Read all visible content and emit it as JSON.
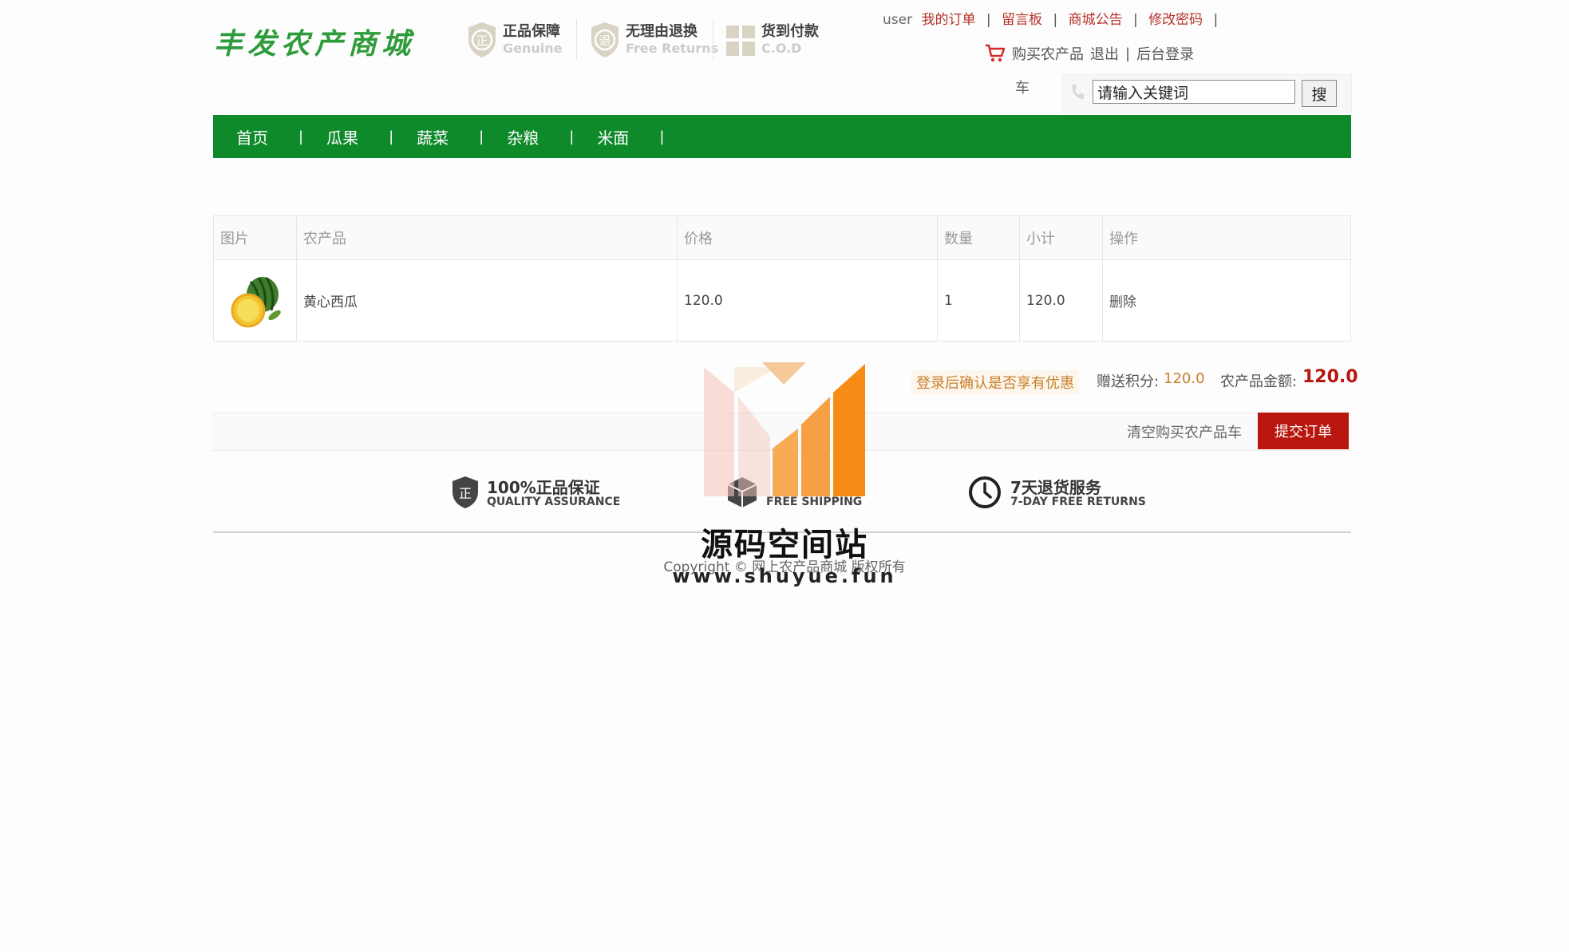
{
  "header": {
    "logo": "丰发农产商城",
    "features": [
      {
        "title": "正品保障",
        "subtitle": "Genuine",
        "icon": "shield-zheng-icon"
      },
      {
        "title": "无理由退换",
        "subtitle": "Free Returns",
        "icon": "shield-tui-icon"
      },
      {
        "title": "货到付款",
        "subtitle": "C.O.D",
        "icon": "gift-box-icon"
      }
    ],
    "toplinks": {
      "user": "user",
      "my_orders": "我的订单",
      "guestbook": "留言板",
      "announcements": "商城公告",
      "change_password": "修改密码",
      "sep": "|"
    },
    "row2": {
      "cart": "购买农产品",
      "cart_wrap": "车",
      "logout": "退出",
      "admin_login": "后台登录"
    },
    "search": {
      "value": "请输入关键词",
      "button": "搜"
    }
  },
  "nav": {
    "items": [
      "首页",
      "瓜果",
      "蔬菜",
      "杂粮",
      "米面"
    ],
    "sep": "|"
  },
  "cart": {
    "columns": [
      "图片",
      "农产品",
      "价格",
      "数量",
      "小计",
      "操作"
    ],
    "rows": [
      {
        "product": "黄心西瓜",
        "price": "120.0",
        "qty": "1",
        "subtotal": "120.0",
        "action": "删除"
      }
    ]
  },
  "summary": {
    "login_discount": "登录后确认是否享有优惠",
    "points_label": "赠送积分:",
    "points_value": "120.0",
    "amount_label": "农产品金额:",
    "amount_value": "120.0"
  },
  "actions": {
    "clear": "清空购买农产品车",
    "submit": "提交订单"
  },
  "services": [
    {
      "title": "100%正品保证",
      "subtitle": "QUALITY ASSURANCE",
      "icon": "shield-check-icon"
    },
    {
      "title": "",
      "subtitle": "FREE SHIPPING",
      "icon": "box-icon"
    },
    {
      "title": "7天退货服务",
      "subtitle": "7-DAY FREE RETURNS",
      "icon": "clock-icon"
    }
  ],
  "footer": {
    "copyright": "Copyright © 网上农产品商城 版权所有"
  },
  "watermark": {
    "text": "源码空间站",
    "url": "www.shuyue.fun"
  },
  "colors": {
    "nav_green": "#0f8a2b",
    "link_red": "#b6312a",
    "submit_red": "#b8160f",
    "logo_green": "#2e9c3a"
  }
}
